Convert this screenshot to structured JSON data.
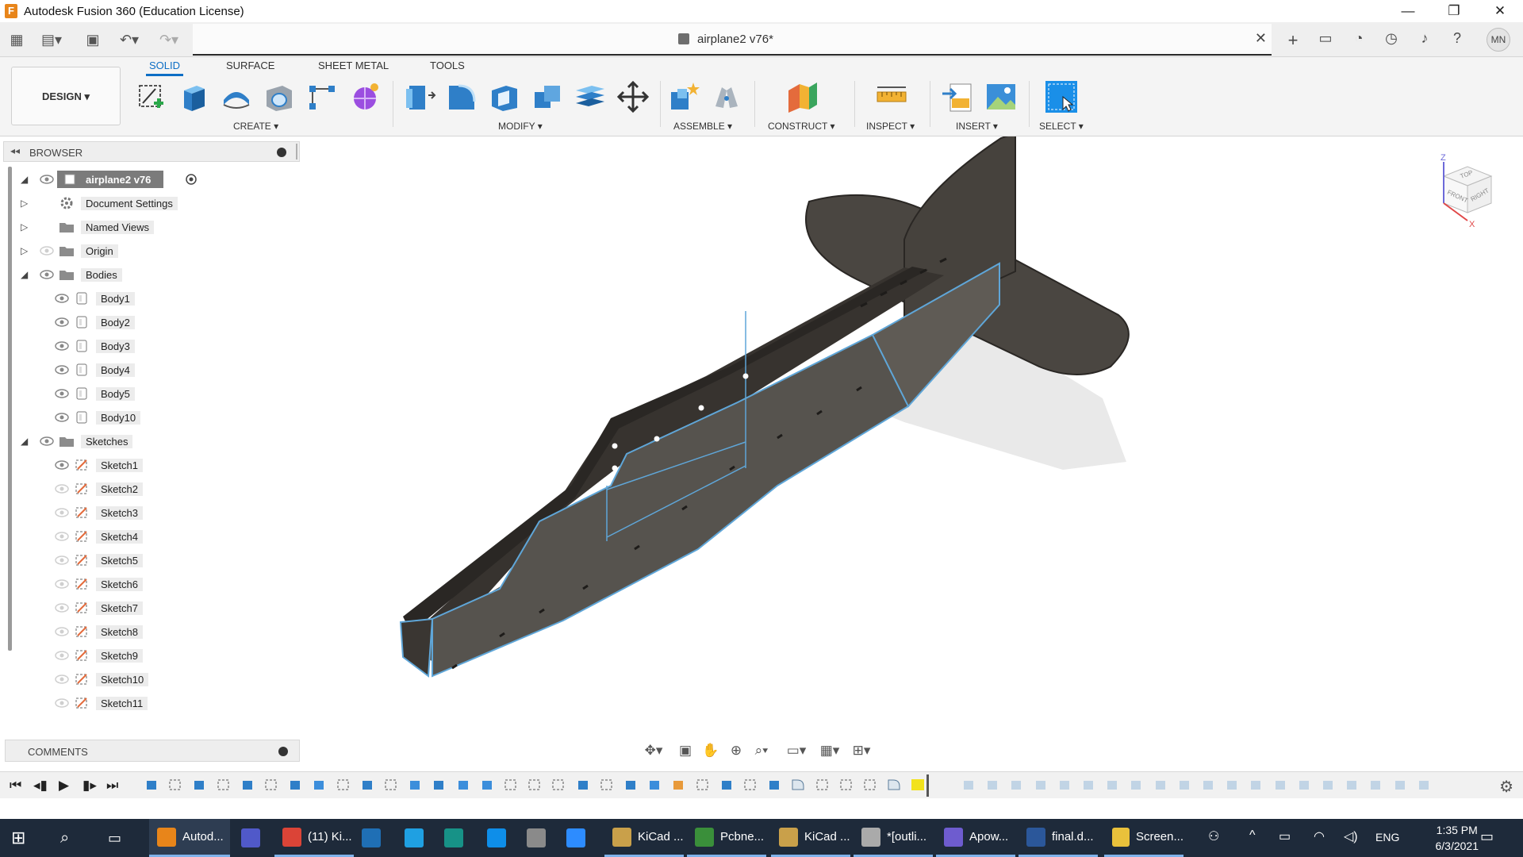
{
  "window": {
    "title": "Autodesk Fusion 360 (Education License)",
    "app_icon_letter": "F",
    "minimize": "—",
    "restore": "❐",
    "close": "✕"
  },
  "document_tab": {
    "title": "airplane2 v76*",
    "close": "✕"
  },
  "user": {
    "initials": "MN"
  },
  "workspace": {
    "label": "DESIGN ▾"
  },
  "ribbon_tabs": [
    "SOLID",
    "SURFACE",
    "SHEET METAL",
    "TOOLS"
  ],
  "ribbon_groups": [
    "CREATE ▾",
    "MODIFY ▾",
    "ASSEMBLE ▾",
    "CONSTRUCT ▾",
    "INSPECT ▾",
    "INSERT ▾",
    "SELECT ▾"
  ],
  "browser": {
    "title": "BROWSER",
    "root": "airplane2 v76",
    "items": [
      {
        "label": "Document Settings"
      },
      {
        "label": "Named Views"
      },
      {
        "label": "Origin"
      },
      {
        "label": "Bodies"
      },
      {
        "label": "Body1"
      },
      {
        "label": "Body2"
      },
      {
        "label": "Body3"
      },
      {
        "label": "Body4"
      },
      {
        "label": "Body5"
      },
      {
        "label": "Body10"
      },
      {
        "label": "Sketches"
      },
      {
        "label": "Sketch1"
      },
      {
        "label": "Sketch2"
      },
      {
        "label": "Sketch3"
      },
      {
        "label": "Sketch4"
      },
      {
        "label": "Sketch5"
      },
      {
        "label": "Sketch6"
      },
      {
        "label": "Sketch7"
      },
      {
        "label": "Sketch8"
      },
      {
        "label": "Sketch9"
      },
      {
        "label": "Sketch10"
      },
      {
        "label": "Sketch11"
      }
    ]
  },
  "comments": {
    "title": "COMMENTS"
  },
  "viewcube": {
    "top": "TOP",
    "front": "FRONT",
    "right": "RIGHT",
    "axis_z": "Z",
    "axis_x": "X"
  },
  "colors": {
    "accent": "#0d6ec5",
    "body_dark": "#4a4641",
    "body_light": "#5b5852",
    "edge_blue": "#5fa6d8"
  },
  "taskbar": {
    "items": [
      {
        "label": "Autod...",
        "icon": "fusion-icon",
        "color": "#e8851a"
      },
      {
        "label": "",
        "icon": "teams-icon",
        "color": "#5059c9"
      },
      {
        "label": "(11) Ki...",
        "icon": "chrome-icon",
        "color": "#db4437"
      },
      {
        "label": "",
        "icon": "app-icon",
        "color": "#1f6fb5"
      },
      {
        "label": "",
        "icon": "ie-icon",
        "color": "#1fa0e2"
      },
      {
        "label": "",
        "icon": "gitkraken-icon",
        "color": "#179287"
      },
      {
        "label": "",
        "icon": "teamviewer-icon",
        "color": "#0e8ee9"
      },
      {
        "label": "",
        "icon": "drone-icon",
        "color": "#8a8a8a"
      },
      {
        "label": "",
        "icon": "zoom-icon",
        "color": "#2d8cff"
      },
      {
        "label": "KiCad ...",
        "icon": "kicad-icon",
        "color": "#c9a04a"
      },
      {
        "label": "Pcbne...",
        "icon": "pcbnew-icon",
        "color": "#3a8f3a"
      },
      {
        "label": "KiCad ...",
        "icon": "kicad-icon",
        "color": "#c9a04a"
      },
      {
        "label": "*[outli...",
        "icon": "notepad-icon",
        "color": "#aaaaaa"
      },
      {
        "label": "Apow...",
        "icon": "apower-icon",
        "color": "#6e5ccf"
      },
      {
        "label": "final.d...",
        "icon": "word-icon",
        "color": "#2b579a"
      },
      {
        "label": "Screen...",
        "icon": "folder-icon",
        "color": "#e9c13b"
      }
    ],
    "language": "ENG",
    "time": "1:35 PM",
    "date": "6/3/2021"
  }
}
